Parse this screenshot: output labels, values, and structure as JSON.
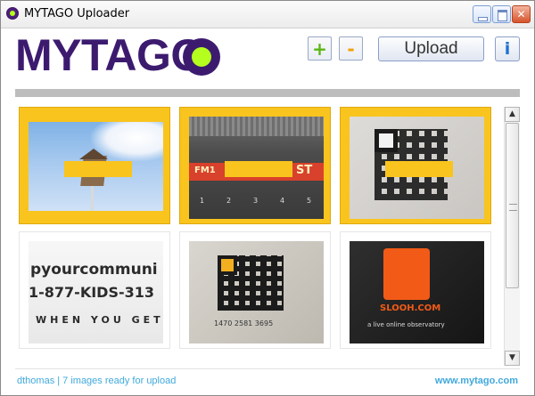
{
  "window": {
    "title": "MYTAGO Uploader",
    "controls": {
      "minimize_icon": "minimize-icon",
      "maximize_icon": "maximize-icon",
      "close_icon": "close-icon"
    }
  },
  "header": {
    "logo_text": "MYTAGO",
    "add_label": "+",
    "remove_label": "-",
    "upload_label": "Upload",
    "info_label": "i"
  },
  "gallery": {
    "images": [
      {
        "subject": "birdhouse on pole against sky",
        "selected": true
      },
      {
        "subject": "car radio display",
        "selected": true,
        "text_visible": [
          "FM1",
          "ST",
          "1",
          "2",
          "3",
          "4",
          "5"
        ]
      },
      {
        "subject": "QR code on paper",
        "selected": true
      },
      {
        "subject": "printed text closeup",
        "selected": false,
        "text_visible": [
          "pyourcommuni",
          "1-877-KIDS-313",
          "WHEN YOU GET"
        ]
      },
      {
        "subject": "QR code with phone number",
        "selected": false,
        "text_visible": [
          "1470 2581 3695"
        ]
      },
      {
        "subject": "SLOOH.COM logo card",
        "selected": false,
        "text_visible": [
          "SLOOH.COM",
          "a live online observatory"
        ]
      }
    ]
  },
  "status": {
    "text": "dthomas | 7 images ready for upload",
    "site_link": "www.mytago.com"
  },
  "colors": {
    "brand_purple": "#3c1b6f",
    "brand_green": "#b4ff1e",
    "selection_yellow": "#f9c41d",
    "link_blue": "#41a9dc"
  }
}
